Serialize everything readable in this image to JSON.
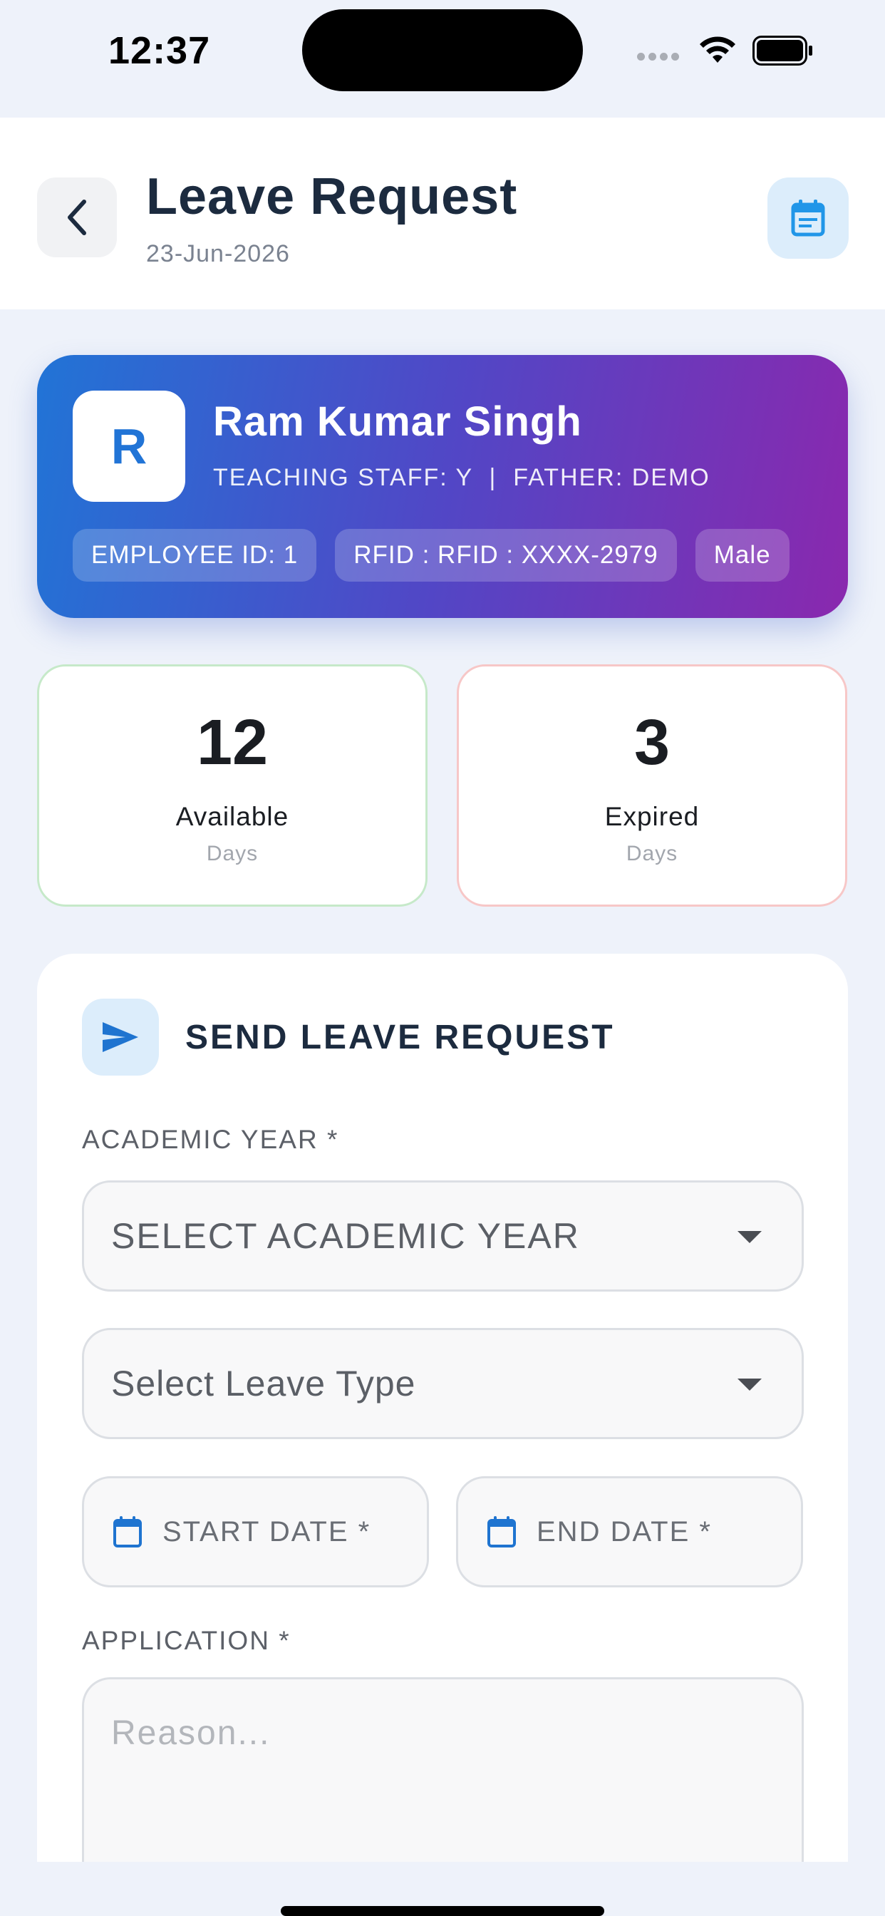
{
  "status_bar": {
    "time": "12:37"
  },
  "header": {
    "title": "Leave Request",
    "date": "23-Jun-2026",
    "back_icon": "chevron-left-icon",
    "action_icon": "calendar-icon"
  },
  "profile": {
    "avatar_letter": "R",
    "name": "Ram Kumar Singh",
    "subtitle": "TEACHING STAFF: Y  |  FATHER: DEMO",
    "chips": [
      "EMPLOYEE ID: 1",
      "RFID : RFID : XXXX-2979",
      "Male"
    ]
  },
  "stats": {
    "available": {
      "value": "12",
      "label": "Available",
      "unit": "Days"
    },
    "expired": {
      "value": "3",
      "label": "Expired",
      "unit": "Days"
    }
  },
  "form": {
    "icon": "send-icon",
    "title": "SEND LEAVE REQUEST",
    "academic_year_label": "ACADEMIC YEAR *",
    "academic_year_value": "SELECT ACADEMIC YEAR",
    "leave_type_value": "Select Leave Type",
    "start_date_placeholder": "START DATE *",
    "end_date_placeholder": "END DATE *",
    "application_label": "APPLICATION *",
    "application_placeholder": "Reason..."
  },
  "colors": {
    "accent": "#2174d6",
    "gradient_end": "#8a28ae",
    "available_border": "#c6e9c9",
    "expired_border": "#f7c7c7"
  }
}
